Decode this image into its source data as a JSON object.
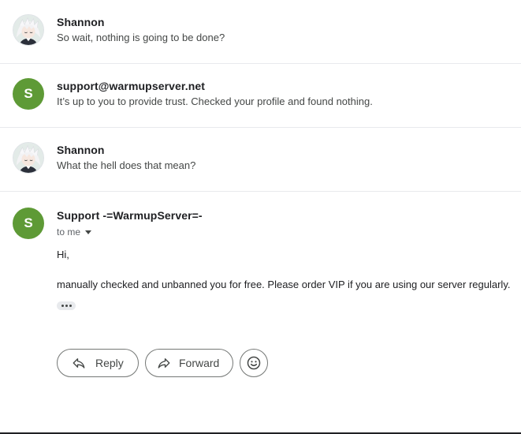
{
  "thread": {
    "messages": [
      {
        "sender": "Shannon",
        "snippet": "So wait, nothing is going to be done?",
        "avatar": {
          "type": "photo",
          "icon": "anime-avatar-photo"
        }
      },
      {
        "sender": "support@warmupserver.net",
        "snippet": "It’s up to you to provide trust. Checked your profile and found nothing.",
        "avatar": {
          "type": "letter",
          "letter": "S",
          "color": "#5e9a36"
        }
      },
      {
        "sender": "Shannon",
        "snippet": "What the hell does that mean?",
        "avatar": {
          "type": "photo",
          "icon": "anime-avatar-photo"
        }
      }
    ],
    "open_message": {
      "sender": "Support -=WarmupServer=-",
      "recipient": "to me",
      "avatar": {
        "type": "letter",
        "letter": "S",
        "color": "#5e9a36"
      },
      "greeting": "Hi,",
      "body": "manually checked and unbanned you for free. Please order VIP if you are using our server regularly."
    }
  },
  "actions": {
    "reply_label": "Reply",
    "forward_label": "Forward",
    "reply_icon": "reply-arrow-icon",
    "forward_icon": "forward-arrow-icon",
    "emoji_icon": "smiley-face-icon"
  },
  "colors": {
    "avatar_green": "#5e9a36",
    "divider": "#e8eaed",
    "text_primary": "#202124",
    "text_secondary": "#444746"
  }
}
